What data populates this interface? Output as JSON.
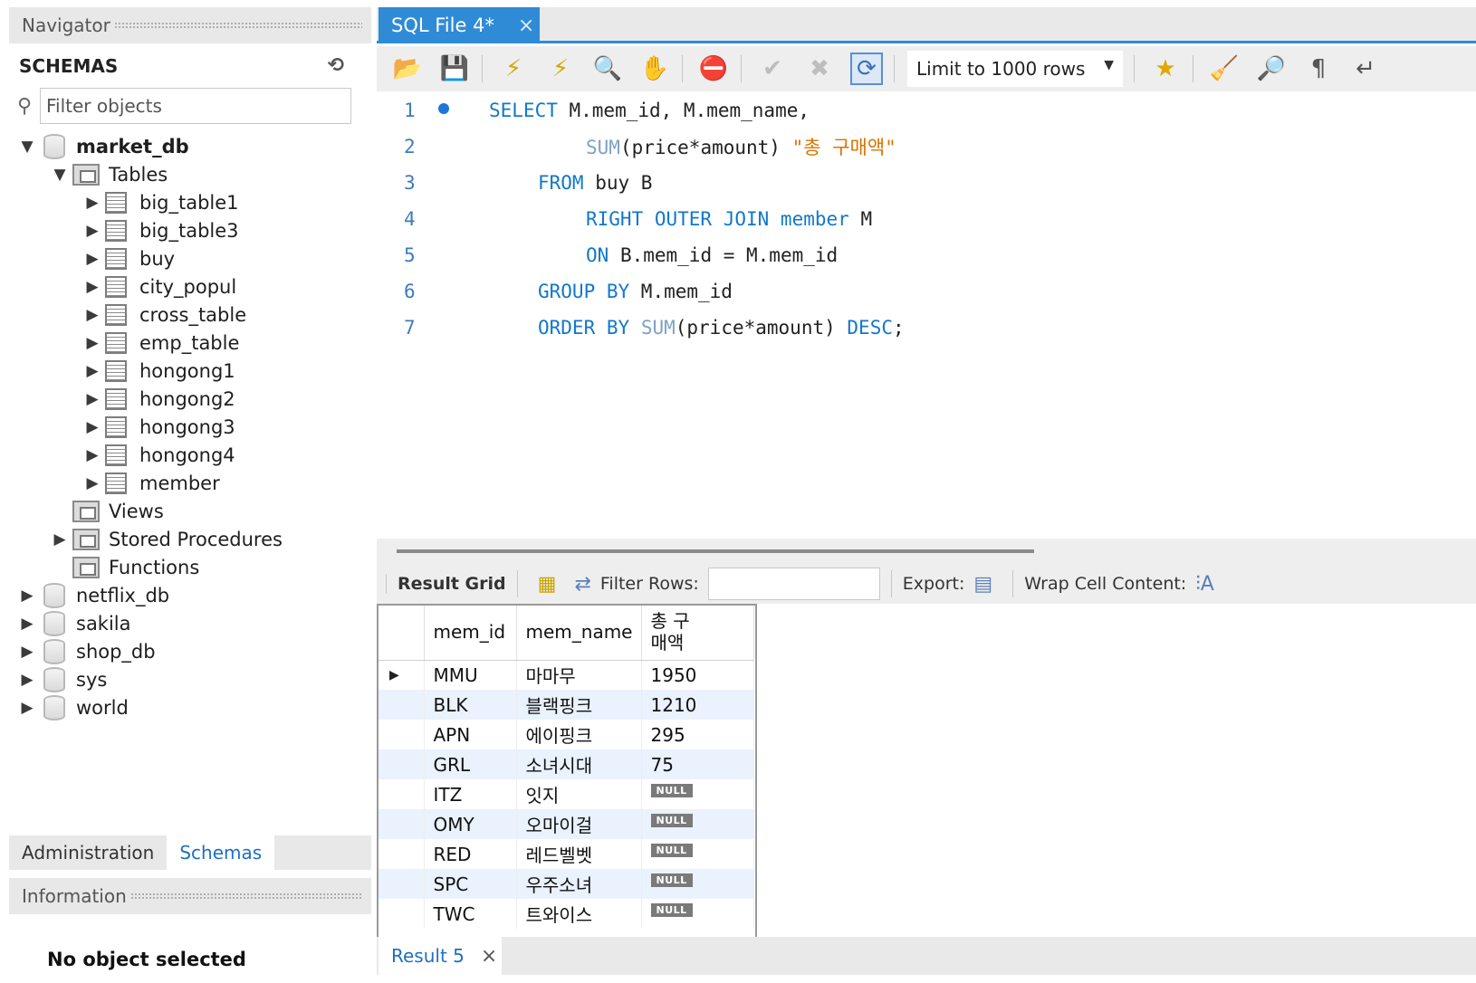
{
  "navigator": {
    "title": "Navigator",
    "schemas_label": "SCHEMAS",
    "filter_placeholder": "Filter objects",
    "tree": {
      "market_db": "market_db",
      "tables": "Tables",
      "table_items": [
        "big_table1",
        "big_table3",
        "buy",
        "city_popul",
        "cross_table",
        "emp_table",
        "hongong1",
        "hongong2",
        "hongong3",
        "hongong4",
        "member"
      ],
      "views": "Views",
      "stored_procedures": "Stored Procedures",
      "functions": "Functions",
      "other_dbs": [
        "netflix_db",
        "sakila",
        "shop_db",
        "sys",
        "world"
      ]
    },
    "tabs": [
      "Administration",
      "Schemas"
    ],
    "info_title": "Information",
    "info_text": "No object selected"
  },
  "editor_tab": {
    "label": "SQL File 4*",
    "close": "×"
  },
  "toolbar": {
    "limit_label": "Limit to 1000 rows"
  },
  "code": {
    "line_numbers": [
      "1",
      "2",
      "3",
      "4",
      "5",
      "6",
      "7"
    ],
    "l1": {
      "kw": "SELECT",
      "rest": " M.mem_id, M.mem_name,"
    },
    "l2": {
      "fn": "SUM",
      "rest": "(price*amount) ",
      "str": "\"총 구매액\""
    },
    "l3": {
      "kw": "FROM",
      "rest": " buy B"
    },
    "l4": {
      "kw": "RIGHT OUTER JOIN member",
      "rest": " M"
    },
    "l5": {
      "kw": "ON",
      "rest": " B.mem_id = M.mem_id"
    },
    "l6": {
      "kw": "GROUP BY",
      "rest": " M.mem_id"
    },
    "l7": {
      "kw": "ORDER BY",
      "fn": "SUM",
      "rest": "(price*amount) ",
      "kw2": "DESC",
      "end": ";"
    }
  },
  "result_bar": {
    "result_grid": "Result Grid",
    "filter_rows": "Filter Rows:",
    "export": "Export:",
    "wrap": "Wrap Cell Content:"
  },
  "grid": {
    "columns": [
      "mem_id",
      "mem_name",
      "총 구\n매액"
    ],
    "rows": [
      [
        "MMU",
        "마마무",
        "1950"
      ],
      [
        "BLK",
        "블랙핑크",
        "1210"
      ],
      [
        "APN",
        "에이핑크",
        "295"
      ],
      [
        "GRL",
        "소녀시대",
        "75"
      ],
      [
        "ITZ",
        "잇지",
        "NULL"
      ],
      [
        "OMY",
        "오마이걸",
        "NULL"
      ],
      [
        "RED",
        "레드벨벳",
        "NULL"
      ],
      [
        "SPC",
        "우주소녀",
        "NULL"
      ],
      [
        "TWC",
        "트와이스",
        "NULL"
      ]
    ]
  },
  "result_tab": {
    "label": "Result 5",
    "close": "×"
  }
}
